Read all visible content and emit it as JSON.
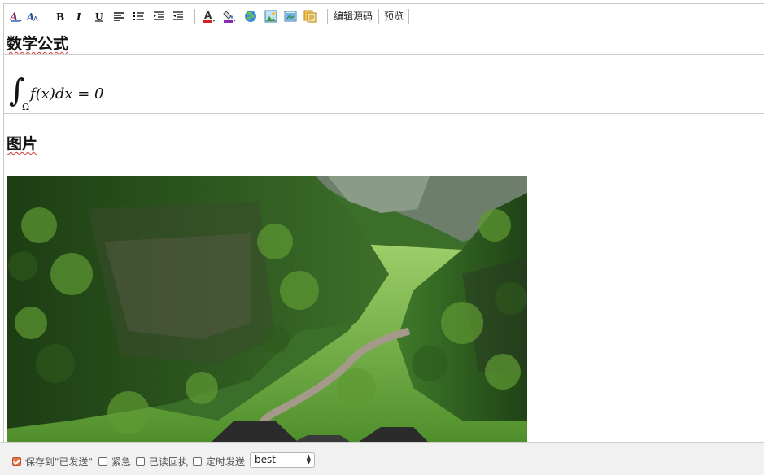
{
  "toolbar": {
    "buttons": [
      {
        "name": "font-family-icon",
        "glyph": "A"
      },
      {
        "name": "font-size-icon",
        "glyph": "A"
      },
      {
        "name": "bold-icon",
        "glyph": "B"
      },
      {
        "name": "italic-icon",
        "glyph": "I"
      },
      {
        "name": "underline-icon",
        "glyph": "U"
      },
      {
        "name": "align-icon"
      },
      {
        "name": "unordered-list-icon"
      },
      {
        "name": "indent-icon"
      },
      {
        "name": "outdent-icon"
      },
      {
        "name": "font-color-icon",
        "glyph": "A"
      },
      {
        "name": "background-color-icon"
      },
      {
        "name": "link-icon"
      },
      {
        "name": "image-icon"
      },
      {
        "name": "screenshot-icon"
      },
      {
        "name": "stationery-icon"
      }
    ],
    "edit_source_label": "编辑源码",
    "preview_label": "预览"
  },
  "content": {
    "heading_math": "数学公式",
    "math": {
      "integral_symbol": "∫",
      "subscript": "Ω",
      "expression": "f(x)dx = 0"
    },
    "heading_image": "图片",
    "image_description_icon": "canyon-photo"
  },
  "bottom": {
    "save_sent_label": "保存到\"已发送\"",
    "save_sent_checked": true,
    "urgent_label": "紧急",
    "urgent_checked": false,
    "read_receipt_label": "已读回执",
    "read_receipt_checked": false,
    "scheduled_label": "定时发送",
    "scheduled_checked": false,
    "select_value": "best"
  },
  "colors": {
    "accent_checkbox": "#e8734a",
    "squiggle": "#d23a3a",
    "font_color_underline": "#d11f1f",
    "bg_color_underline": "#8a2bb5"
  }
}
